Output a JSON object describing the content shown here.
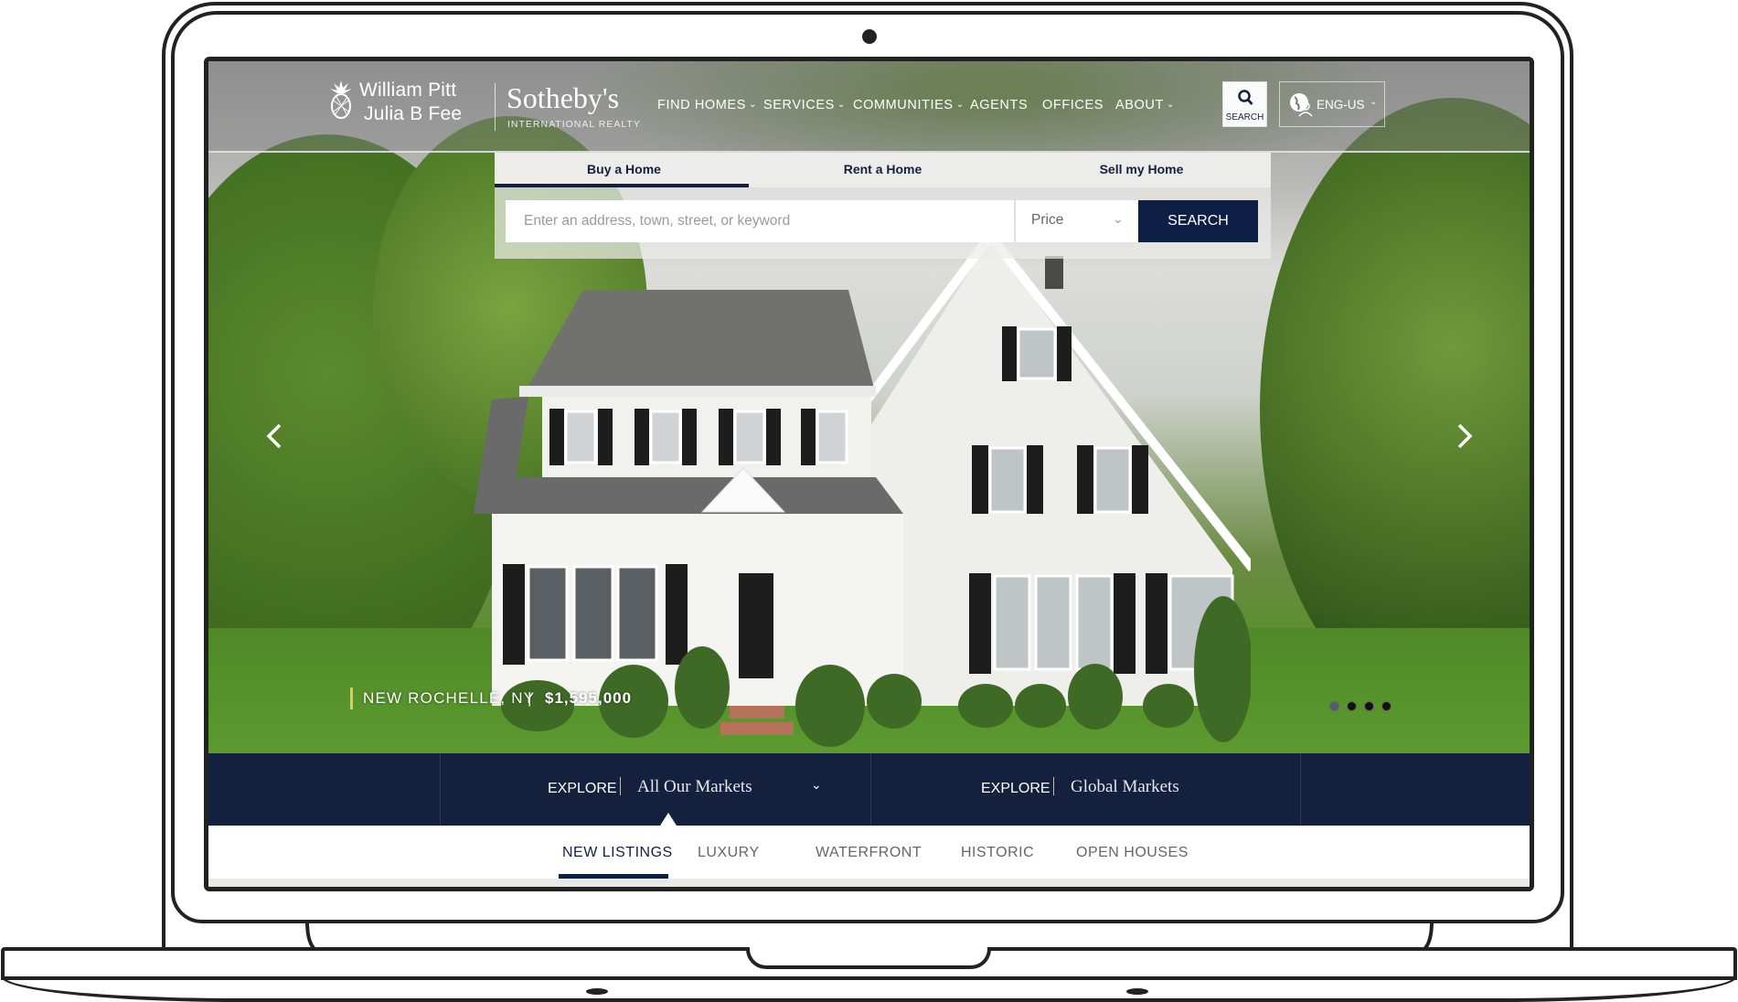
{
  "brand": {
    "line1": "William Pitt",
    "line2": "Julia B Fee",
    "sothebys": "Sotheby's",
    "sub": "INTERNATIONAL REALTY"
  },
  "nav": {
    "items": [
      {
        "label": "FIND  HOMES",
        "dropdown": true
      },
      {
        "label": "SERVICES",
        "dropdown": true
      },
      {
        "label": "COMMUNITIES",
        "dropdown": true
      },
      {
        "label": "AGENTS",
        "dropdown": false
      },
      {
        "label": "OFFICES",
        "dropdown": false
      },
      {
        "label": "ABOUT",
        "dropdown": true
      }
    ],
    "chevron": "⌄",
    "search_label": "SEARCH",
    "language": "ENG-US"
  },
  "search_panel": {
    "tabs": [
      {
        "label": "Buy a Home",
        "active": true
      },
      {
        "label": "Rent a Home",
        "active": false
      },
      {
        "label": "Sell my Home",
        "active": false
      }
    ],
    "address_placeholder": "Enter an address, town, street, or keyword",
    "price_label": "Price",
    "search_button": "SEARCH"
  },
  "hero": {
    "location": "NEW ROCHELLE, NY",
    "separator": "|",
    "price": "$1,595,000",
    "slides_total": 4,
    "active_slide": 1
  },
  "explore": {
    "label": "EXPLORE",
    "left_value": "All Our Markets",
    "right_value": "Global Markets"
  },
  "listing_tabs": [
    {
      "label": "NEW LISTINGS",
      "active": true
    },
    {
      "label": "LUXURY",
      "active": false
    },
    {
      "label": "WATERFRONT",
      "active": false
    },
    {
      "label": "HISTORIC",
      "active": false
    },
    {
      "label": "OPEN HOUSES",
      "active": false
    }
  ],
  "colors": {
    "navy": "#13213f",
    "accent_gold": "#e6c84a"
  }
}
